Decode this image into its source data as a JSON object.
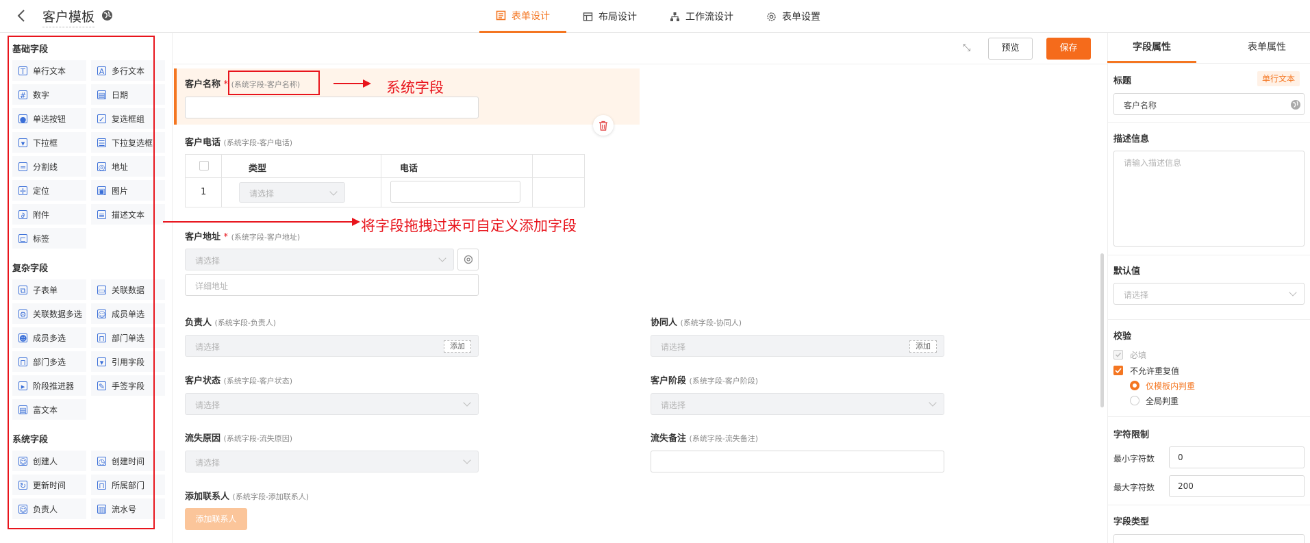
{
  "header": {
    "title": "客户模板",
    "tabs": [
      {
        "label": "表单设计",
        "icon": "form-icon",
        "active": true
      },
      {
        "label": "布局设计",
        "icon": "layout-icon",
        "active": false
      },
      {
        "label": "工作流设计",
        "icon": "workflow-icon",
        "active": false
      },
      {
        "label": "表单设置",
        "icon": "settings-icon",
        "active": false
      }
    ]
  },
  "palette": {
    "basic_title": "基础字段",
    "basic": [
      "单行文本",
      "多行文本",
      "数字",
      "日期",
      "单选按钮",
      "复选框组",
      "下拉框",
      "下拉复选框",
      "分割线",
      "地址",
      "定位",
      "图片",
      "附件",
      "描述文本",
      "标签"
    ],
    "complex_title": "复杂字段",
    "complex": [
      "子表单",
      "关联数据",
      "关联数据多选",
      "成员单选",
      "成员多选",
      "部门单选",
      "部门多选",
      "引用字段",
      "阶段推进器",
      "手签字段",
      "富文本"
    ],
    "system_title": "系统字段",
    "system": [
      "创建人",
      "创建时间",
      "更新时间",
      "所属部门",
      "负责人",
      "流水号"
    ]
  },
  "toolbar": {
    "preview": "预览",
    "save": "保存"
  },
  "canvas": {
    "customer_name": {
      "label": "客户名称",
      "required": "*",
      "sys": "(系统字段-客户名称)"
    },
    "customer_phone": {
      "label": "客户电话",
      "sys": "(系统字段-客户电话)",
      "col_type": "类型",
      "col_phone": "电话",
      "row_no": "1",
      "select_ph": "请选择"
    },
    "customer_address": {
      "label": "客户地址",
      "required": "*",
      "sys": "(系统字段-客户地址)",
      "select_ph": "请选择",
      "detail_ph": "详细地址"
    },
    "owner": {
      "label": "负责人",
      "sys": "(系统字段-负责人)",
      "ph": "请选择",
      "add": "添加"
    },
    "collaborator": {
      "label": "协同人",
      "sys": "(系统字段-协同人)",
      "ph": "请选择",
      "add": "添加"
    },
    "status": {
      "label": "客户状态",
      "sys": "(系统字段-客户状态)",
      "ph": "请选择"
    },
    "stage": {
      "label": "客户阶段",
      "sys": "(系统字段-客户阶段)",
      "ph": "请选择"
    },
    "loss_reason": {
      "label": "流失原因",
      "sys": "(系统字段-流失原因)",
      "ph": "请选择"
    },
    "loss_note": {
      "label": "流失备注",
      "sys": "(系统字段-流失备注)"
    },
    "add_contact": {
      "label": "添加联系人",
      "sys": "(系统字段-添加联系人)",
      "button": "添加联系人"
    }
  },
  "annotations": {
    "system_field": "系统字段",
    "drag_hint": "将字段拖拽过来可自定义添加字段"
  },
  "props": {
    "tab_field": "字段属性",
    "tab_form": "表单属性",
    "title_label": "标题",
    "type_badge": "单行文本",
    "title_value": "客户名称",
    "desc_label": "描述信息",
    "desc_ph": "请输入描述信息",
    "default_label": "默认值",
    "default_ph": "请选择",
    "validate_label": "校验",
    "required": "必填",
    "no_dup": "不允许重复值",
    "in_template": "仅模板内判重",
    "global": "全局判重",
    "char_limit_label": "字符限制",
    "min_label": "最小字符数",
    "min_value": "0",
    "max_label": "最大字符数",
    "max_value": "200",
    "field_type_label": "字段类型"
  },
  "colors": {
    "accent": "#f47621",
    "annotation": "#e8141c",
    "icon": "#3a6fd8"
  }
}
